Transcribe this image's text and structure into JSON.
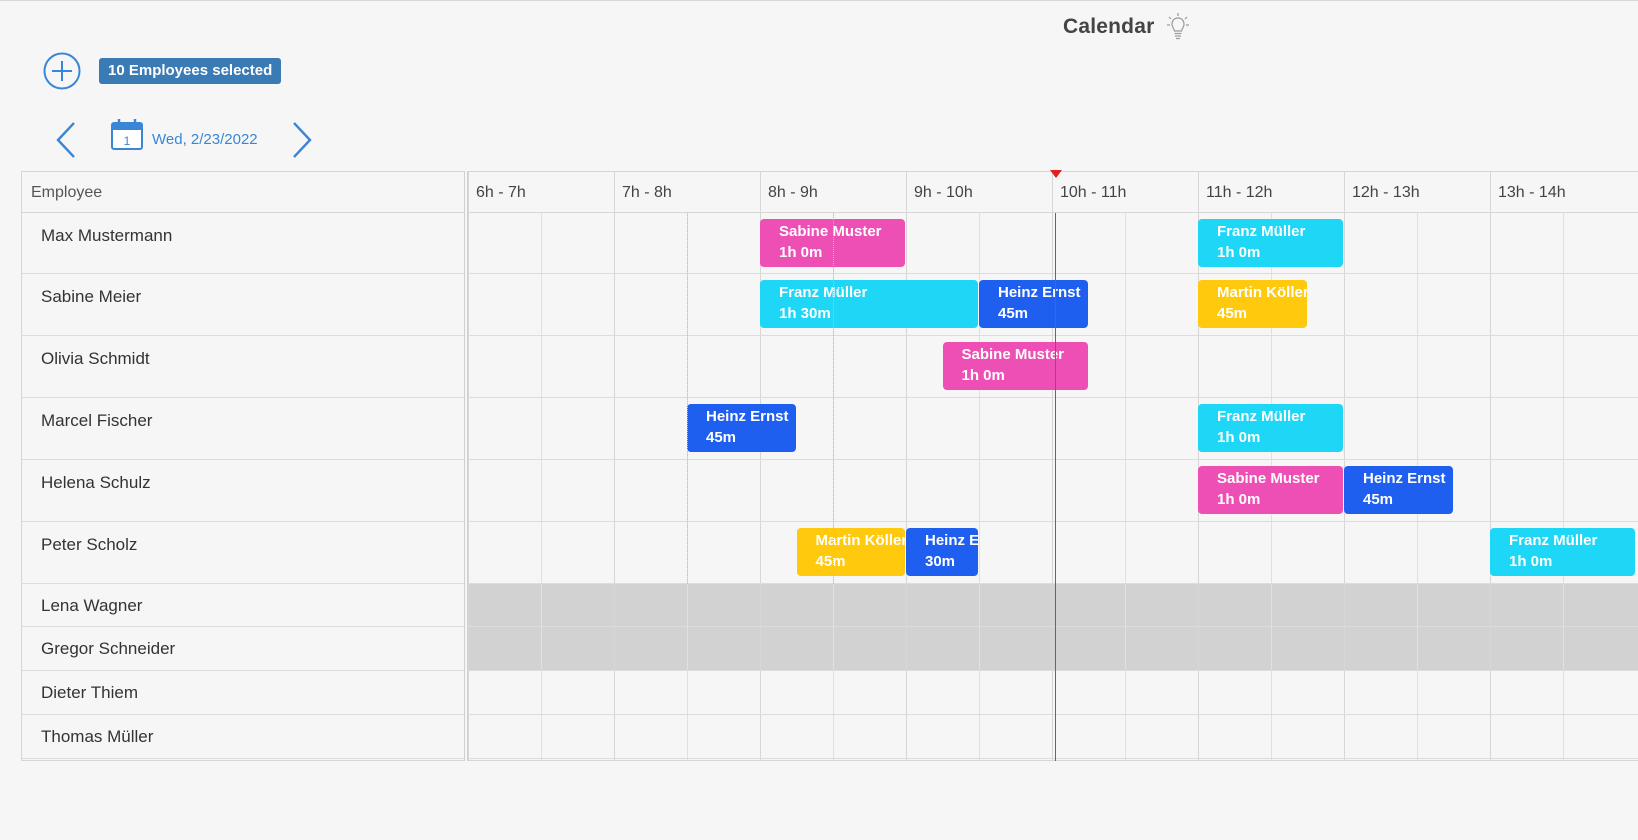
{
  "app": {
    "title": "Calendar",
    "selection_badge": "10 Employees selected",
    "date_label": "Wed, 2/23/2022",
    "calendar_day": "1"
  },
  "grid": {
    "employee_header": "Employee",
    "time_slots": [
      "6h - 7h",
      "7h - 8h",
      "8h - 9h",
      "9h - 10h",
      "10h - 11h",
      "11h - 12h",
      "12h - 13h",
      "13h - 14h"
    ],
    "employees": [
      "Max Mustermann",
      "Sabine Meier",
      "Olivia Schmidt",
      "Marcel Fischer",
      "Helena Schulz",
      "Peter Scholz",
      "Lena Wagner",
      "Gregor Schneider",
      "Dieter Thiem",
      "Thomas Müller"
    ],
    "unavailable_employees": [
      "Lena Wagner",
      "Gregor Schneider"
    ]
  },
  "events": [
    {
      "row": 0,
      "name": "Sabine Muster",
      "duration": "1h 0m",
      "start": "8:00",
      "end": "9:00",
      "color": "#ee4fb5"
    },
    {
      "row": 0,
      "name": "Franz Müller",
      "duration": "1h 0m",
      "start": "11:00",
      "end": "12:00",
      "color": "#1ed6f6"
    },
    {
      "row": 1,
      "name": "Franz Müller",
      "duration": "1h 30m",
      "start": "8:00",
      "end": "9:30",
      "color": "#1ed6f6"
    },
    {
      "row": 1,
      "name": "Heinz Ernst",
      "duration": "45m",
      "start": "9:30",
      "end": "10:15",
      "color": "#1f5ff0"
    },
    {
      "row": 1,
      "name": "Martin Köller",
      "duration": "45m",
      "start": "11:00",
      "end": "11:45",
      "color": "#ffc90e"
    },
    {
      "row": 2,
      "name": "Sabine Muster",
      "duration": "1h 0m",
      "start": "9:15",
      "end": "10:15",
      "color": "#ee4fb5"
    },
    {
      "row": 3,
      "name": "Heinz Ernst",
      "duration": "45m",
      "start": "7:30",
      "end": "8:15",
      "color": "#1f5ff0"
    },
    {
      "row": 3,
      "name": "Franz Müller",
      "duration": "1h 0m",
      "start": "11:00",
      "end": "12:00",
      "color": "#1ed6f6"
    },
    {
      "row": 4,
      "name": "Sabine Muster",
      "duration": "1h 0m",
      "start": "11:00",
      "end": "12:00",
      "color": "#ee4fb5"
    },
    {
      "row": 4,
      "name": "Heinz Ernst",
      "duration": "45m",
      "start": "12:00",
      "end": "12:45",
      "color": "#1f5ff0"
    },
    {
      "row": 5,
      "name": "Martin Köller",
      "duration": "45m",
      "start": "8:15",
      "end": "9:00",
      "color": "#ffc90e"
    },
    {
      "row": 5,
      "name": "Heinz Ernst",
      "duration": "30m",
      "start": "9:00",
      "end": "9:30",
      "color": "#1f5ff0"
    },
    {
      "row": 5,
      "name": "Franz Müller",
      "duration": "1h 0m",
      "start": "13:00",
      "end": "14:00",
      "color": "#1ed6f6"
    }
  ],
  "current_time": "10:02",
  "colors": {
    "accent": "#3a86d6",
    "badge": "#3a7ab5",
    "now_line": "#e23232",
    "unavailable": "#d2d2d2"
  },
  "icons": [
    "lightbulb-icon",
    "plus-circle-icon",
    "chevron-left-icon",
    "calendar-icon",
    "chevron-right-icon"
  ]
}
